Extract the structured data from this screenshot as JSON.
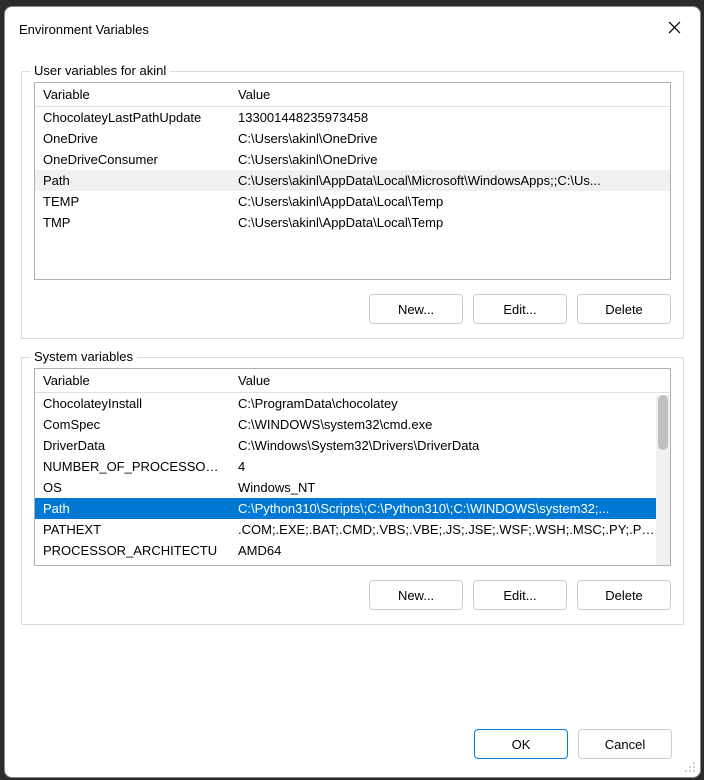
{
  "dialog": {
    "title": "Environment Variables"
  },
  "user_group": {
    "label": "User variables for akinl",
    "header_var": "Variable",
    "header_val": "Value",
    "rows": [
      {
        "name": "ChocolateyLastPathUpdate",
        "value": "133001448235973458"
      },
      {
        "name": "OneDrive",
        "value": "C:\\Users\\akinl\\OneDrive"
      },
      {
        "name": "OneDriveConsumer",
        "value": "C:\\Users\\akinl\\OneDrive"
      },
      {
        "name": "Path",
        "value": "C:\\Users\\akinl\\AppData\\Local\\Microsoft\\WindowsApps;;C:\\Us..."
      },
      {
        "name": "TEMP",
        "value": "C:\\Users\\akinl\\AppData\\Local\\Temp"
      },
      {
        "name": "TMP",
        "value": "C:\\Users\\akinl\\AppData\\Local\\Temp"
      }
    ],
    "buttons": {
      "new": "New...",
      "edit": "Edit...",
      "delete": "Delete"
    }
  },
  "system_group": {
    "label": "System variables",
    "header_var": "Variable",
    "header_val": "Value",
    "rows": [
      {
        "name": "ChocolateyInstall",
        "value": "C:\\ProgramData\\chocolatey"
      },
      {
        "name": "ComSpec",
        "value": "C:\\WINDOWS\\system32\\cmd.exe"
      },
      {
        "name": "DriverData",
        "value": "C:\\Windows\\System32\\Drivers\\DriverData"
      },
      {
        "name": "NUMBER_OF_PROCESSORS",
        "value": "4"
      },
      {
        "name": "OS",
        "value": "Windows_NT"
      },
      {
        "name": "Path",
        "value": "C:\\Python310\\Scripts\\;C:\\Python310\\;C:\\WINDOWS\\system32;..."
      },
      {
        "name": "PATHEXT",
        "value": ".COM;.EXE;.BAT;.CMD;.VBS;.VBE;.JS;.JSE;.WSF;.WSH;.MSC;.PY;.PYW"
      },
      {
        "name": "PROCESSOR_ARCHITECTU",
        "value": "AMD64"
      }
    ],
    "buttons": {
      "new": "New...",
      "edit": "Edit...",
      "delete": "Delete"
    }
  },
  "footer": {
    "ok": "OK",
    "cancel": "Cancel"
  },
  "highlight_user_row": 3,
  "selected_system_row": 5
}
